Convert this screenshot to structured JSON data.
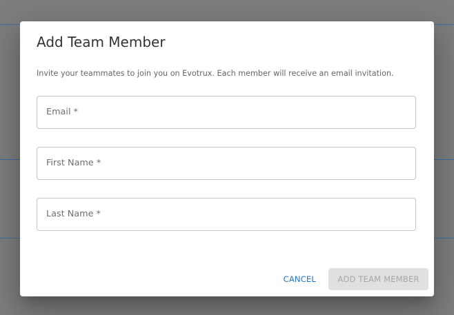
{
  "dialog": {
    "title": "Add Team Member",
    "description": "Invite your teammates to join you on Evotrux. Each member will receive an email invitation."
  },
  "form": {
    "email": {
      "label": "Email *",
      "value": ""
    },
    "first_name": {
      "label": "First Name *",
      "value": ""
    },
    "last_name": {
      "label": "Last Name *",
      "value": ""
    }
  },
  "actions": {
    "cancel_label": "CANCEL",
    "submit_label": "ADD TEAM MEMBER",
    "submit_disabled": true
  },
  "colors": {
    "backdrop": "#7d7d7d",
    "accent": "#1f76c9",
    "disabled_bg": "#e0e0e0",
    "disabled_text": "#a6a6a6"
  }
}
